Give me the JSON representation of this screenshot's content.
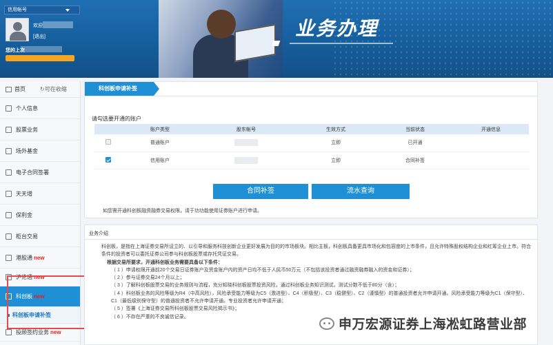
{
  "header": {
    "account_select": "信用帐号",
    "welcome": "欢迎",
    "logout": "[退出]",
    "last_login_label": "您的上次",
    "title": "业务办理"
  },
  "sidebar": {
    "home": "首页",
    "collapse": "可在收缩",
    "items": [
      {
        "label": "个人信息",
        "new": ""
      },
      {
        "label": "股票业务",
        "new": ""
      },
      {
        "label": "场外基金",
        "new": ""
      },
      {
        "label": "电子合同签署",
        "new": ""
      },
      {
        "label": "天天增",
        "new": ""
      },
      {
        "label": "保利金",
        "new": ""
      },
      {
        "label": "柜台交易",
        "new": ""
      },
      {
        "label": "港股通",
        "new": "new"
      },
      {
        "label": "沪伦通",
        "new": "new"
      },
      {
        "label": "科创板",
        "new": "new"
      }
    ],
    "sub_item": "科创板申请补签",
    "last_item": {
      "label": "投顾签约业务",
      "new": "new"
    }
  },
  "main": {
    "tab": "科创板申请补签",
    "prompt": "请勾选要开通的账户",
    "table": {
      "headers": [
        "",
        "账户类型",
        "股东帐号",
        "生效方式",
        "当前状态",
        "开通信息"
      ],
      "rows": [
        {
          "checked": false,
          "type": "普通账户",
          "effect": "立即",
          "status": "已开通",
          "info": ""
        },
        {
          "checked": true,
          "type": "信用账户",
          "effect": "立即",
          "status": "合同补签",
          "info": ""
        }
      ]
    },
    "buttons": {
      "sign": "合同补签",
      "query": "流水查询"
    },
    "note": "如您需开通科创板融资融券交易权限，请于功功能使用证券账户进行申请。"
  },
  "intro": {
    "title": "业务介绍",
    "paragraph": "科创板，是指在上海证券交易所设立的、以引导和服务科技创新企业更好发展为目的的市场板块。相比主板，科创板具备更具市场化和包容度的上市条件，且允许特殊股权结构企业和红筹企业上市。符合条件的投资者可以委托证券公司参与科创板股票或存托凭证交易。",
    "conditions_title": "根据交易所要求，开通科创板业务需要具备以下条件：",
    "items": [
      "（ 1 ）申请权限开通前20个交易日证券账户及资金账户内的资产日均不低于人民币50万元（不包括该投资者通过融资融券融入的资金和证券）；",
      "（ 2 ）参与证券交易24个月以上；",
      "（ 3 ）了解科创板股票交易的业务规则与流程，充分知晓科创板股票投资风险，通过科创板业务知识测试，测试分数不低于80分（含）；",
      "（ 4 ）科创板业务的风险等级为R4（中高风险），风险承受能力等级为C5（激进型）、C4（积极型）、C3（稳健型）、C2（谨慎型）的普通投资者允许申请开通。风险承受能力等级为C1（保守型）、C1（最低级别保守型）的普通投资者不允许申请开通。专业投资者允许申请开通；",
      "（ 5 ）签署《上海证券交易所科创板股票交易风险揭示书》；",
      "（ 6 ）不存在严重的不良诚信记录。"
    ]
  },
  "watermark": "申万宏源证券上海凇虹路营业部"
}
